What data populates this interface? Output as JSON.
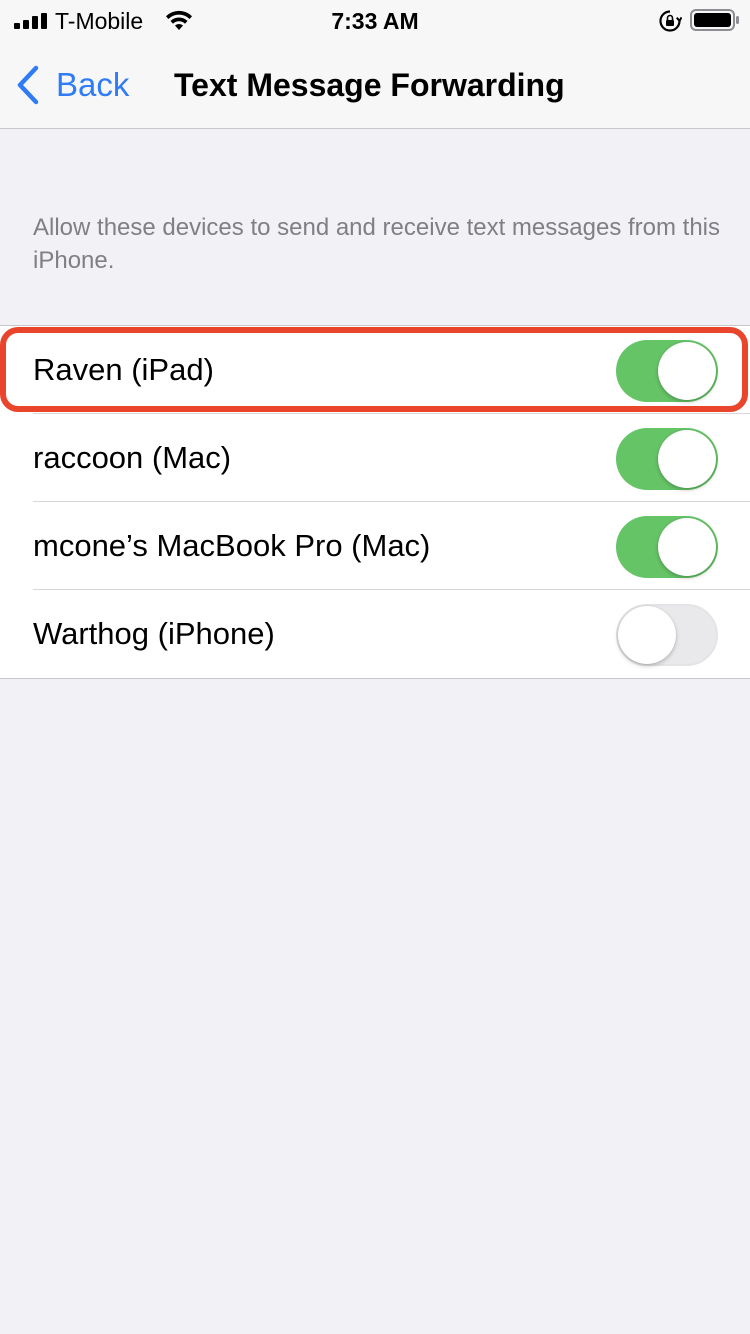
{
  "status_bar": {
    "carrier": "T-Mobile",
    "time": "7:33 AM",
    "icons": [
      "signal-icon",
      "wifi-icon",
      "orientation-lock-icon",
      "battery-icon"
    ]
  },
  "nav": {
    "back_label": "Back",
    "title": "Text Message Forwarding"
  },
  "section": {
    "footer": "Allow these devices to send and receive text messages from this iPhone."
  },
  "devices": [
    {
      "name": "Raven (iPad)",
      "enabled": true
    },
    {
      "name": "raccoon (Mac)",
      "enabled": true
    },
    {
      "name": "mcone’s MacBook Pro (Mac)",
      "enabled": true
    },
    {
      "name": "Warthog (iPhone)",
      "enabled": false
    }
  ],
  "colors": {
    "accent": "#2f7cf6",
    "switch_on": "#65c466",
    "switch_off": "#e9e9eb",
    "highlight": "#e8452c",
    "background": "#f1f1f6"
  }
}
